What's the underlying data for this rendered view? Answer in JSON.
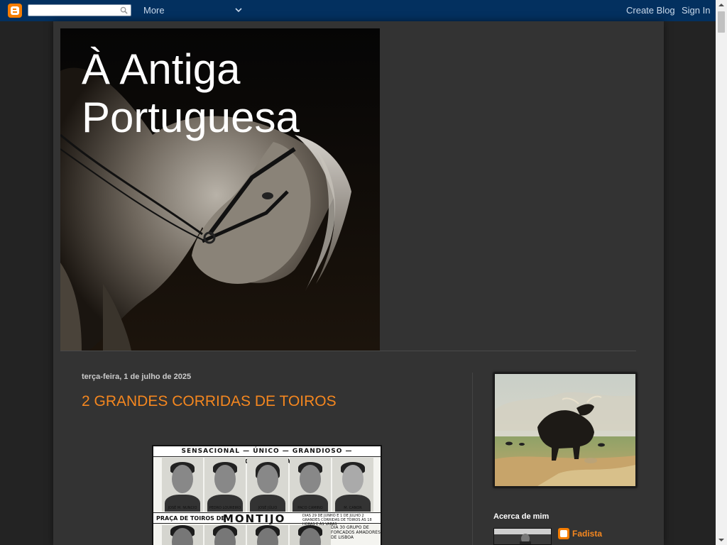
{
  "navbar": {
    "search_placeholder": "",
    "more_label": "More",
    "create_blog_label": "Create Blog",
    "sign_in_label": "Sign In"
  },
  "header": {
    "title_line1": "À Antiga",
    "title_line2": "Portuguesa"
  },
  "post": {
    "date": "terça-feira, 1 de julho de 2025",
    "title": "2 GRANDES CORRIDAS DE TOIROS",
    "poster": {
      "top_banner": "SENSACIONAL — ÚNICO — GRANDIOSO — MONUMENTAL",
      "portrait_names": [
        "JOSÉ M. NUNCIO",
        "PEDRO LOUREIRO",
        "JOSÉ JÚLIO",
        "PACO CAMINO",
        "M. CANOR"
      ],
      "praca_label": "PRAÇA DE TOIROS DE",
      "town": "MONTIJO",
      "dates_text": "DIAS 29 DE JUNHO E 1 DE JULHO 2 GRANDES CORRIDAS DE TOIROS ÀS 18 HORAS E ÀS VARAS",
      "side_text": "DIA 30 GRUPO DE FORCADOS AMADORES DE LISBOA"
    }
  },
  "sidebar": {
    "about_title": "Acerca de mim",
    "author_name": "Fadista"
  },
  "colors": {
    "navbar_bg": "#03305f",
    "page_bg": "#232323",
    "content_bg": "#333333",
    "accent": "#f5871f",
    "blogger_orange": "#f57d00"
  },
  "icons": {
    "blogger": "blogger-logo-icon",
    "search": "search-icon",
    "chevron": "chevron-down-icon"
  }
}
